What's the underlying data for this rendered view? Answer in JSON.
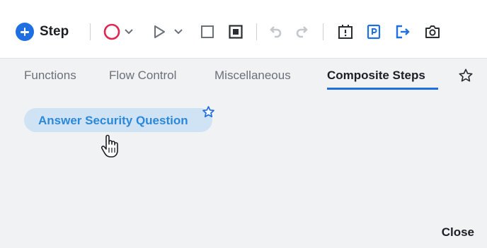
{
  "toolbar": {
    "step_label": "Step",
    "icons": {
      "add_step": "plus-circle-icon",
      "record": "record-circle-icon",
      "run": "play-icon",
      "stop": "stop-square-icon",
      "stop_record": "stop-record-icon",
      "undo": "undo-icon",
      "redo": "redo-icon",
      "checkpoint": "checkpoint-icon",
      "export": "export-document-icon",
      "exit": "exit-icon",
      "screenshot": "camera-icon"
    }
  },
  "tabs": [
    {
      "label": "Functions"
    },
    {
      "label": "Flow Control"
    },
    {
      "label": "Miscellaneous"
    },
    {
      "label": "Composite Steps"
    }
  ],
  "active_tab": "Composite Steps",
  "composite_steps": [
    {
      "label": "Answer Security Question",
      "favorited": true
    }
  ],
  "footer": {
    "close_label": "Close"
  },
  "colors": {
    "accent_blue": "#1f6fe0",
    "record_red": "#e0264f",
    "chip_bg": "#d0e3f5",
    "chip_text": "#2b88d8",
    "panel_bg": "#f1f2f4"
  }
}
